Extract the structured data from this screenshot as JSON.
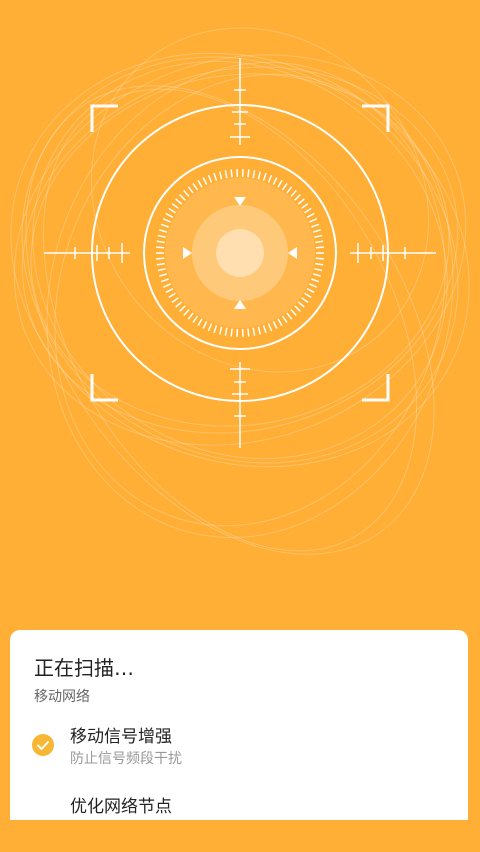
{
  "scan_card": {
    "title": "正在扫描…",
    "network_type": "移动网络",
    "tasks": [
      {
        "title": "移动信号增强",
        "description": "防止信号频段干扰",
        "status": "done"
      },
      {
        "title": "优化网络节点",
        "description": "",
        "status": "pending"
      }
    ]
  },
  "colors": {
    "background": "#FFAE36",
    "check": "#F7B733",
    "card": "#FFFFFF"
  }
}
